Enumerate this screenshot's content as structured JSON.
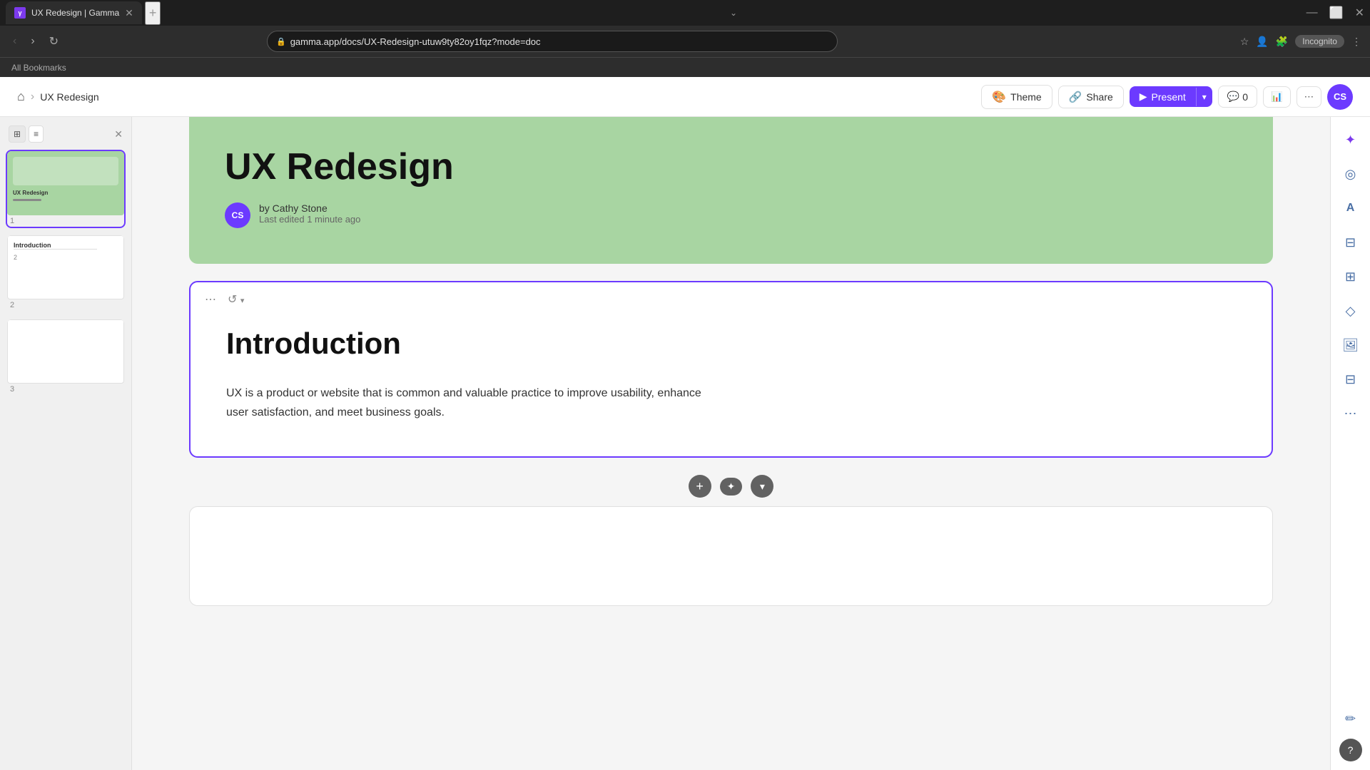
{
  "browser": {
    "tab_title": "UX Redesign | Gamma",
    "url": "gamma.app/docs/UX-Redesign-utuw9ty82oy1fqz?mode=doc",
    "incognito_label": "Incognito",
    "bookmarks_label": "All Bookmarks"
  },
  "topbar": {
    "home_icon": "⌂",
    "breadcrumb_sep": "›",
    "breadcrumb_current": "UX Redesign",
    "theme_label": "Theme",
    "share_label": "Share",
    "present_label": "Present",
    "comment_count": "0",
    "avatar_initials": "CS"
  },
  "sidebar": {
    "slide1": {
      "title": "UX Redesign",
      "num": "1"
    },
    "slide2": {
      "title": "Introduction",
      "num": "2"
    },
    "slide3": {
      "num": "3"
    }
  },
  "header_card": {
    "title": "UX Redesign",
    "author": "by Cathy Stone",
    "last_edited": "Last edited 1 minute ago",
    "avatar_initials": "CS"
  },
  "intro_card": {
    "heading": "Introduction",
    "body": "UX is a product or website that is common and valuable practice to improve usability, enhance user satisfaction, and meet business goals."
  },
  "card_toolbar": {
    "dots_icon": "⋯",
    "rotate_icon": "↺"
  },
  "add_toolbar": {
    "plus_icon": "+",
    "move_icon": "✦",
    "chevron_icon": "▾"
  },
  "right_sidebar": {
    "ai_icon": "✦",
    "format_icon": "◎",
    "text_icon": "A",
    "card_icon": "▦",
    "layout_icon": "⊞",
    "shape_icon": "◇",
    "image_icon": "⊡",
    "table_icon": "⊟",
    "more_icon": "⋯",
    "edit_icon": "✏",
    "help_label": "?"
  }
}
